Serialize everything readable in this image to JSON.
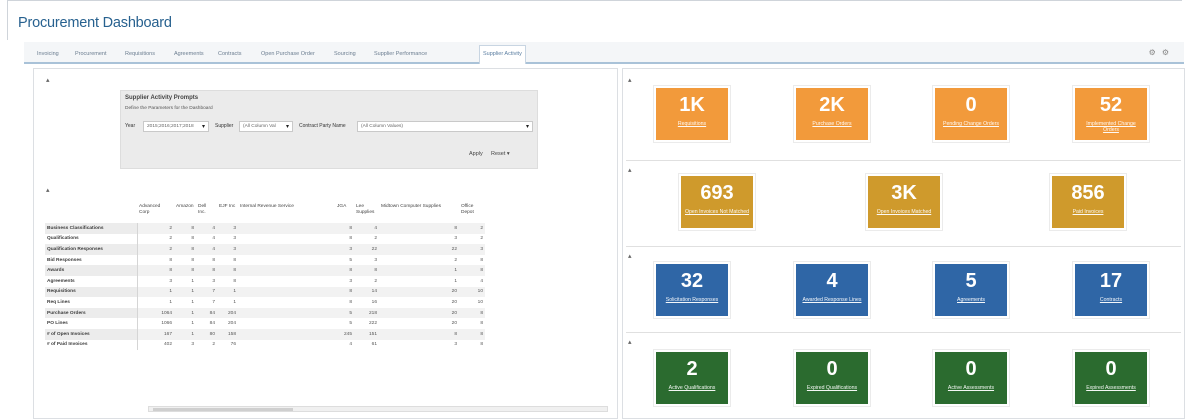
{
  "header": {
    "title": "Procurement Dashboard"
  },
  "tabs": [
    {
      "label": "Invoicing"
    },
    {
      "label": "Procurement"
    },
    {
      "label": "Requisitions"
    },
    {
      "label": "Agreements"
    },
    {
      "label": "Contracts"
    },
    {
      "label": "Open Purchase Order"
    },
    {
      "label": "Sourcing"
    },
    {
      "label": "Supplier Performance"
    },
    {
      "label": "Supplier Activity"
    }
  ],
  "top_icons": [
    "settings-icon",
    "options-icon"
  ],
  "collapse_glyph": "▴",
  "prompts": {
    "title": "Supplier Activity Prompts",
    "subtitle": "Define the Parameters for the Dashboard",
    "year_label": "Year",
    "year_value": "2015;2016;2017;2018",
    "supplier_label": "Supplier",
    "supplier_value": "(All Column Val",
    "contract_party_label": "Contract Party Name",
    "contract_party_value": "(All Column Values)",
    "dropdown_glyph": "▾",
    "apply_label": "Apply",
    "reset_label": "Reset ▾"
  },
  "table": {
    "columns": [
      "Advanced Corp",
      "Amazon",
      "Dell Inc.",
      "EJF Inc",
      "Internal Revenue Service",
      "JGA",
      "Lee Supplies",
      "Midtown Computer Supplies",
      "Office Depot"
    ],
    "rows": [
      {
        "label": "Business Classifications",
        "values": [
          "2",
          "8",
          "4",
          "3",
          "",
          "8",
          "4",
          "8",
          "2"
        ]
      },
      {
        "label": "Qualifications",
        "values": [
          "2",
          "8",
          "4",
          "3",
          "",
          "8",
          "2",
          "3",
          "2"
        ]
      },
      {
        "label": "Qualification Responses",
        "values": [
          "2",
          "8",
          "4",
          "3",
          "",
          "3",
          "22",
          "22",
          "3"
        ]
      },
      {
        "label": "Bid Responses",
        "values": [
          "8",
          "8",
          "8",
          "8",
          "",
          "5",
          "3",
          "2",
          "8"
        ]
      },
      {
        "label": "Awards",
        "values": [
          "8",
          "8",
          "8",
          "8",
          "",
          "8",
          "8",
          "1",
          "8"
        ]
      },
      {
        "label": "Agreements",
        "values": [
          "3",
          "1",
          "3",
          "8",
          "",
          "3",
          "2",
          "1",
          "4"
        ]
      },
      {
        "label": "Requisitions",
        "values": [
          "1",
          "1",
          "7",
          "1",
          "",
          "8",
          "14",
          "20",
          "10"
        ]
      },
      {
        "label": "Req Lines",
        "values": [
          "1",
          "1",
          "7",
          "1",
          "",
          "8",
          "16",
          "20",
          "10"
        ]
      },
      {
        "label": "Purchase Orders",
        "values": [
          "1064",
          "1",
          "84",
          "204",
          "",
          "5",
          "218",
          "20",
          "8"
        ]
      },
      {
        "label": "PO Lines",
        "values": [
          "1066",
          "1",
          "84",
          "204",
          "",
          "5",
          "222",
          "20",
          "8"
        ]
      },
      {
        "label": "# of Open Invoices",
        "values": [
          "167",
          "1",
          "80",
          "158",
          "",
          "245",
          "151",
          "8",
          "8"
        ]
      },
      {
        "label": "# of Paid Invoices",
        "values": [
          "402",
          "3",
          "2",
          "76",
          "",
          "4",
          "61",
          "3",
          "8"
        ]
      }
    ]
  },
  "tiles": {
    "orange": [
      {
        "value": "1K",
        "label": "Requisitions"
      },
      {
        "value": "2K",
        "label": "Purchase Orders"
      },
      {
        "value": "0",
        "label": "Pending Change Orders"
      },
      {
        "value": "52",
        "label": "Implemented Change Orders"
      }
    ],
    "gold": [
      {
        "value": "693",
        "label": "Open Invoices Not Matched"
      },
      {
        "value": "3K",
        "label": "Open Invoices Matched"
      },
      {
        "value": "856",
        "label": "Paid Invoices"
      }
    ],
    "blue": [
      {
        "value": "32",
        "label": "Solicitation Responses"
      },
      {
        "value": "4",
        "label": "Awarded Response Lines"
      },
      {
        "value": "5",
        "label": "Agreements"
      },
      {
        "value": "17",
        "label": "Contracts"
      }
    ],
    "green": [
      {
        "value": "2",
        "label": "Active Qualifications"
      },
      {
        "value": "0",
        "label": "Expired Qualifications"
      },
      {
        "value": "0",
        "label": "Active Assessments"
      },
      {
        "value": "0",
        "label": "Expired Assessments"
      }
    ]
  },
  "colors": {
    "orange": "#f29a3b",
    "gold": "#cf9a2c",
    "blue": "#2f66a6",
    "green": "#2b6b2f",
    "title": "#27618f"
  }
}
